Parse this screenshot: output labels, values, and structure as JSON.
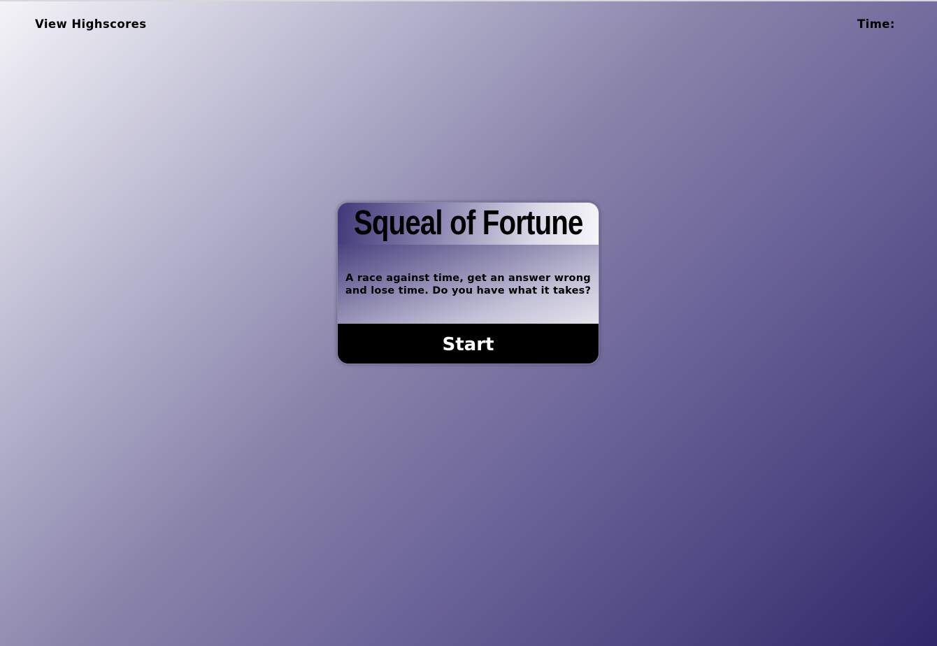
{
  "header": {
    "highscores_label": "View Highscores",
    "time_label": "Time:"
  },
  "card": {
    "title": "Squeal of Fortune",
    "description": "A race against time, get an answer wrong and lose time. Do you have what it takes?",
    "start_label": "Start"
  }
}
